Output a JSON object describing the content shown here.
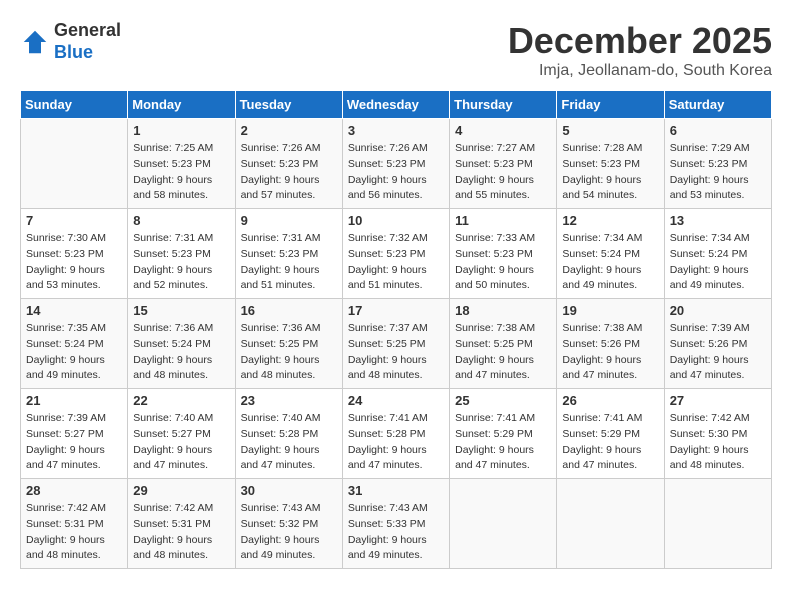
{
  "logo": {
    "general": "General",
    "blue": "Blue"
  },
  "title": "December 2025",
  "location": "Imja, Jeollanam-do, South Korea",
  "days_of_week": [
    "Sunday",
    "Monday",
    "Tuesday",
    "Wednesday",
    "Thursday",
    "Friday",
    "Saturday"
  ],
  "weeks": [
    [
      {
        "day": "",
        "info": ""
      },
      {
        "day": "1",
        "info": "Sunrise: 7:25 AM\nSunset: 5:23 PM\nDaylight: 9 hours\nand 58 minutes."
      },
      {
        "day": "2",
        "info": "Sunrise: 7:26 AM\nSunset: 5:23 PM\nDaylight: 9 hours\nand 57 minutes."
      },
      {
        "day": "3",
        "info": "Sunrise: 7:26 AM\nSunset: 5:23 PM\nDaylight: 9 hours\nand 56 minutes."
      },
      {
        "day": "4",
        "info": "Sunrise: 7:27 AM\nSunset: 5:23 PM\nDaylight: 9 hours\nand 55 minutes."
      },
      {
        "day": "5",
        "info": "Sunrise: 7:28 AM\nSunset: 5:23 PM\nDaylight: 9 hours\nand 54 minutes."
      },
      {
        "day": "6",
        "info": "Sunrise: 7:29 AM\nSunset: 5:23 PM\nDaylight: 9 hours\nand 53 minutes."
      }
    ],
    [
      {
        "day": "7",
        "info": "Sunrise: 7:30 AM\nSunset: 5:23 PM\nDaylight: 9 hours\nand 53 minutes."
      },
      {
        "day": "8",
        "info": "Sunrise: 7:31 AM\nSunset: 5:23 PM\nDaylight: 9 hours\nand 52 minutes."
      },
      {
        "day": "9",
        "info": "Sunrise: 7:31 AM\nSunset: 5:23 PM\nDaylight: 9 hours\nand 51 minutes."
      },
      {
        "day": "10",
        "info": "Sunrise: 7:32 AM\nSunset: 5:23 PM\nDaylight: 9 hours\nand 51 minutes."
      },
      {
        "day": "11",
        "info": "Sunrise: 7:33 AM\nSunset: 5:23 PM\nDaylight: 9 hours\nand 50 minutes."
      },
      {
        "day": "12",
        "info": "Sunrise: 7:34 AM\nSunset: 5:24 PM\nDaylight: 9 hours\nand 49 minutes."
      },
      {
        "day": "13",
        "info": "Sunrise: 7:34 AM\nSunset: 5:24 PM\nDaylight: 9 hours\nand 49 minutes."
      }
    ],
    [
      {
        "day": "14",
        "info": "Sunrise: 7:35 AM\nSunset: 5:24 PM\nDaylight: 9 hours\nand 49 minutes."
      },
      {
        "day": "15",
        "info": "Sunrise: 7:36 AM\nSunset: 5:24 PM\nDaylight: 9 hours\nand 48 minutes."
      },
      {
        "day": "16",
        "info": "Sunrise: 7:36 AM\nSunset: 5:25 PM\nDaylight: 9 hours\nand 48 minutes."
      },
      {
        "day": "17",
        "info": "Sunrise: 7:37 AM\nSunset: 5:25 PM\nDaylight: 9 hours\nand 48 minutes."
      },
      {
        "day": "18",
        "info": "Sunrise: 7:38 AM\nSunset: 5:25 PM\nDaylight: 9 hours\nand 47 minutes."
      },
      {
        "day": "19",
        "info": "Sunrise: 7:38 AM\nSunset: 5:26 PM\nDaylight: 9 hours\nand 47 minutes."
      },
      {
        "day": "20",
        "info": "Sunrise: 7:39 AM\nSunset: 5:26 PM\nDaylight: 9 hours\nand 47 minutes."
      }
    ],
    [
      {
        "day": "21",
        "info": "Sunrise: 7:39 AM\nSunset: 5:27 PM\nDaylight: 9 hours\nand 47 minutes."
      },
      {
        "day": "22",
        "info": "Sunrise: 7:40 AM\nSunset: 5:27 PM\nDaylight: 9 hours\nand 47 minutes."
      },
      {
        "day": "23",
        "info": "Sunrise: 7:40 AM\nSunset: 5:28 PM\nDaylight: 9 hours\nand 47 minutes."
      },
      {
        "day": "24",
        "info": "Sunrise: 7:41 AM\nSunset: 5:28 PM\nDaylight: 9 hours\nand 47 minutes."
      },
      {
        "day": "25",
        "info": "Sunrise: 7:41 AM\nSunset: 5:29 PM\nDaylight: 9 hours\nand 47 minutes."
      },
      {
        "day": "26",
        "info": "Sunrise: 7:41 AM\nSunset: 5:29 PM\nDaylight: 9 hours\nand 47 minutes."
      },
      {
        "day": "27",
        "info": "Sunrise: 7:42 AM\nSunset: 5:30 PM\nDaylight: 9 hours\nand 48 minutes."
      }
    ],
    [
      {
        "day": "28",
        "info": "Sunrise: 7:42 AM\nSunset: 5:31 PM\nDaylight: 9 hours\nand 48 minutes."
      },
      {
        "day": "29",
        "info": "Sunrise: 7:42 AM\nSunset: 5:31 PM\nDaylight: 9 hours\nand 48 minutes."
      },
      {
        "day": "30",
        "info": "Sunrise: 7:43 AM\nSunset: 5:32 PM\nDaylight: 9 hours\nand 49 minutes."
      },
      {
        "day": "31",
        "info": "Sunrise: 7:43 AM\nSunset: 5:33 PM\nDaylight: 9 hours\nand 49 minutes."
      },
      {
        "day": "",
        "info": ""
      },
      {
        "day": "",
        "info": ""
      },
      {
        "day": "",
        "info": ""
      }
    ]
  ]
}
